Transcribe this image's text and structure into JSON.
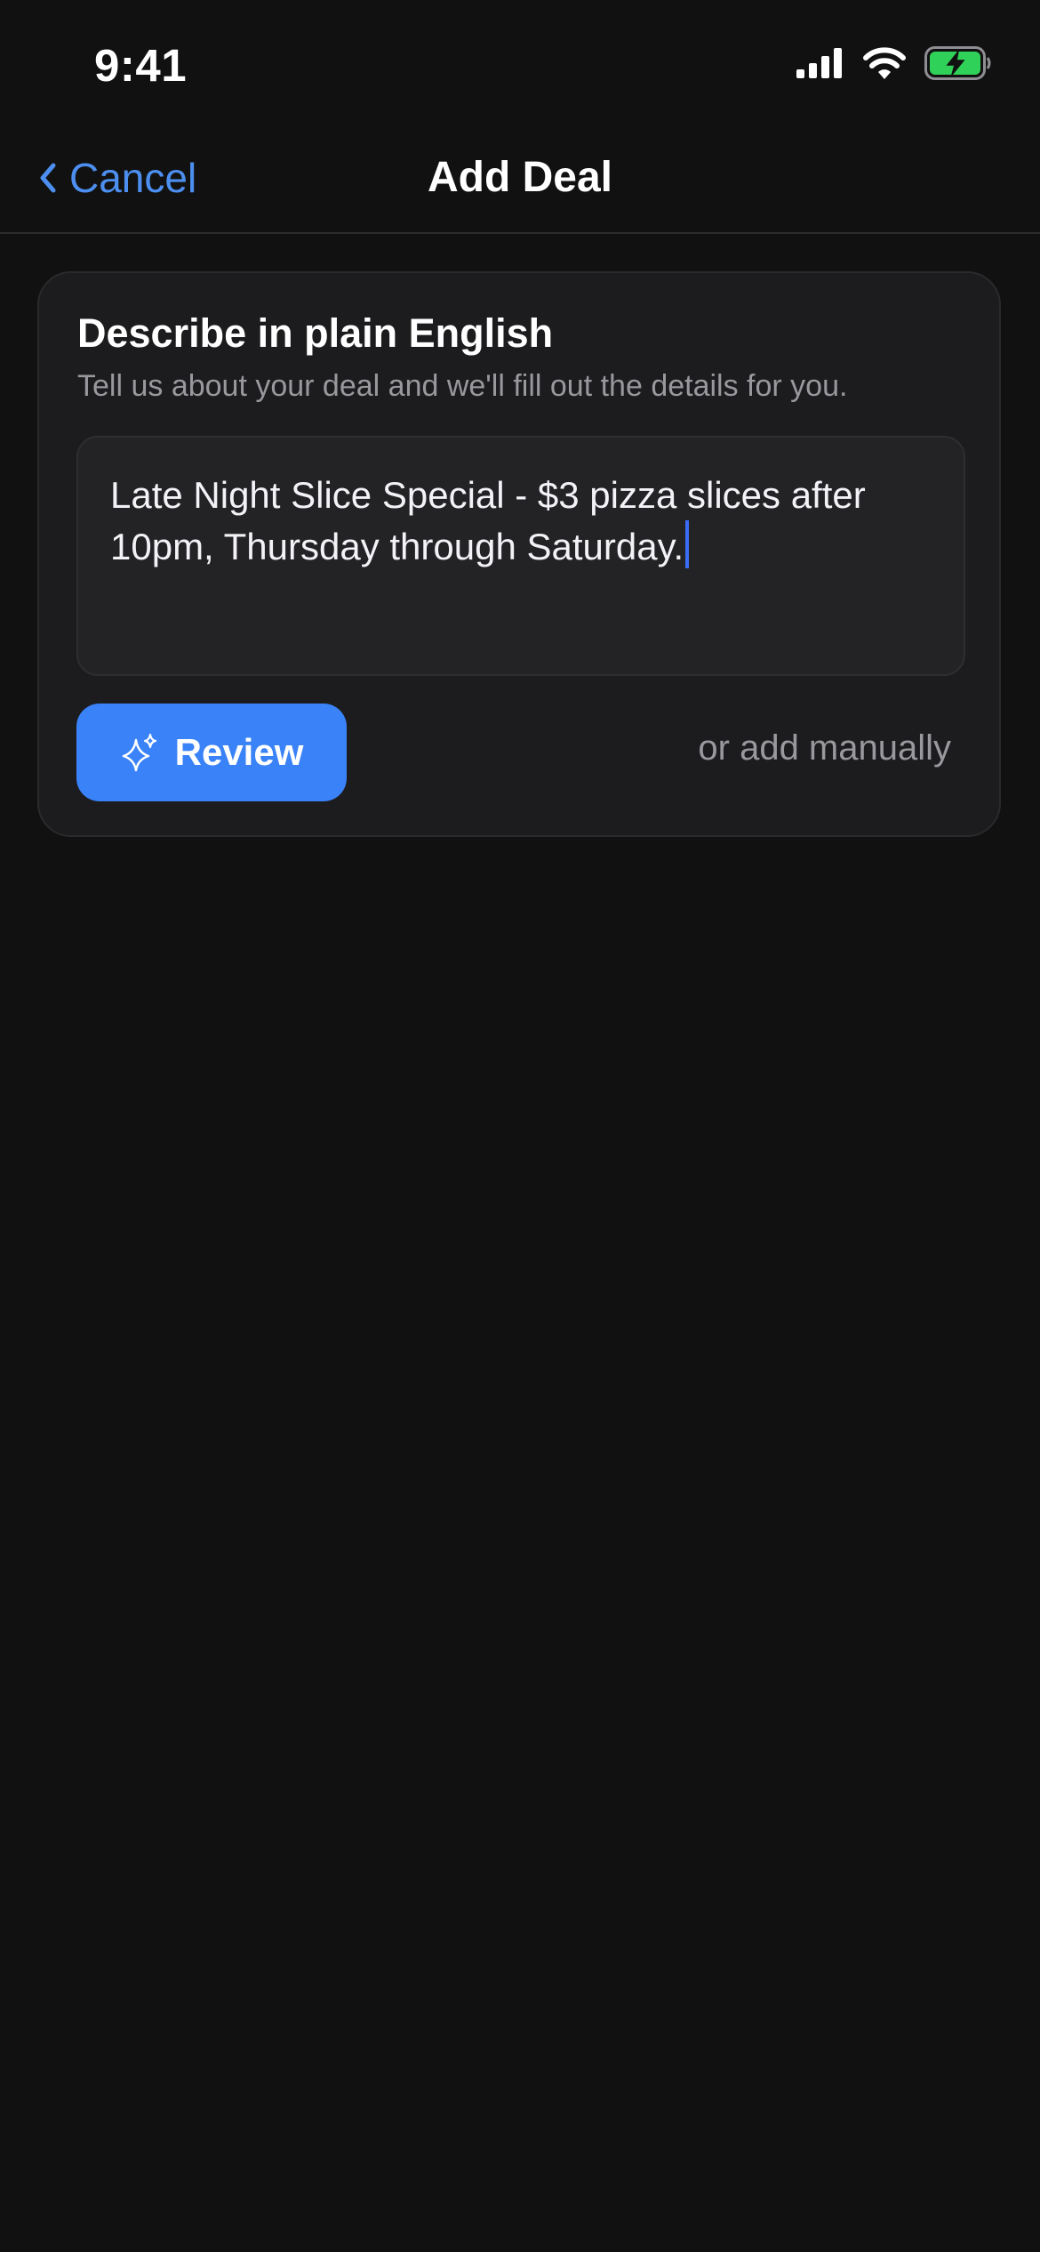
{
  "status_bar": {
    "time": "9:41",
    "icons": [
      "cellular-signal-icon",
      "wifi-icon",
      "battery-charging-icon"
    ],
    "battery_color": "#30d158"
  },
  "nav": {
    "back_label": "Cancel",
    "title": "Add Deal",
    "accent_color": "#4d8ff0"
  },
  "describe_card": {
    "heading": "Describe in plain English",
    "subtitle": "Tell us about your deal and we'll fill out the details for you.",
    "input_value": "Late Night Slice Special - $3 pizza slices after 10pm, Thursday through Saturday.",
    "review_button_label": "Review",
    "review_button_icon": "sparkles-icon",
    "review_button_color": "#3a82f7",
    "manual_link_label": "or add manually"
  }
}
